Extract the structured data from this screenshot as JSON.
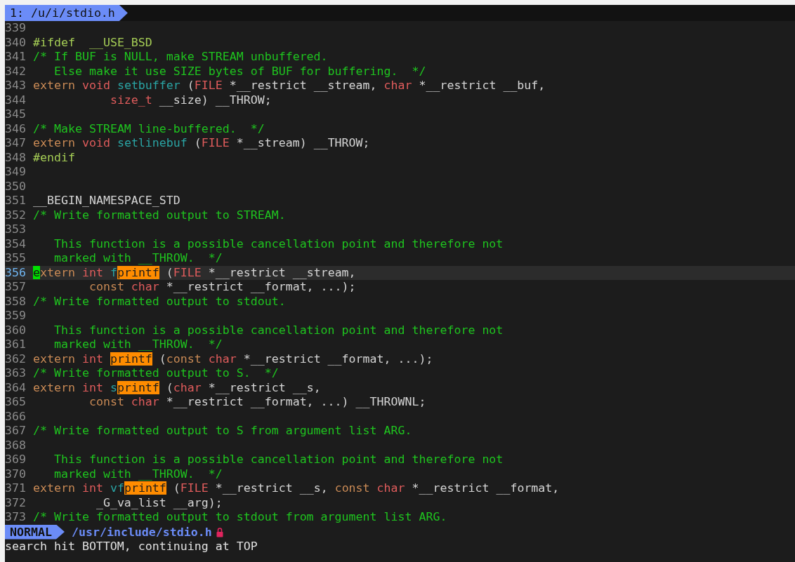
{
  "tabline": {
    "label": "1: /u/i/stdio.h"
  },
  "lines": [
    {
      "number": "339",
      "current": false
    },
    {
      "number": "340",
      "current": false,
      "tokens": [
        {
          "kind": "preproc",
          "text": "#ifdef  __USE_BSD"
        }
      ]
    },
    {
      "number": "341",
      "current": false,
      "tokens": [
        {
          "kind": "comment",
          "text": "/* If BUF is NULL, make STREAM unbuffered."
        }
      ]
    },
    {
      "number": "342",
      "current": false,
      "tokens": [
        {
          "kind": "comment",
          "text": "   Else make it use SIZE bytes of BUF for buffering.  */"
        }
      ]
    },
    {
      "number": "343",
      "current": false,
      "tokens": [
        {
          "kind": "keyword",
          "text": "extern"
        },
        {
          "kind": "type",
          "text": " void"
        },
        {
          "kind": "function",
          "text": " setbuffer"
        },
        {
          "kind": "plain",
          "text": " ("
        },
        {
          "kind": "type",
          "text": "FILE"
        },
        {
          "kind": "plain",
          "text": " *__restrict __stream, "
        },
        {
          "kind": "type",
          "text": "char"
        },
        {
          "kind": "plain",
          "text": " *__restrict __buf,"
        }
      ]
    },
    {
      "number": "344",
      "current": false,
      "tokens": [
        {
          "kind": "type",
          "text": "           size_t"
        },
        {
          "kind": "plain",
          "text": " __size) __THROW;"
        }
      ]
    },
    {
      "number": "345",
      "current": false
    },
    {
      "number": "346",
      "current": false,
      "tokens": [
        {
          "kind": "comment",
          "text": "/* Make STREAM line-buffered.  */"
        }
      ]
    },
    {
      "number": "347",
      "current": false,
      "tokens": [
        {
          "kind": "keyword",
          "text": "extern"
        },
        {
          "kind": "type",
          "text": " void"
        },
        {
          "kind": "function",
          "text": " setlinebuf"
        },
        {
          "kind": "plain",
          "text": " ("
        },
        {
          "kind": "type",
          "text": "FILE"
        },
        {
          "kind": "plain",
          "text": " *__stream) __THROW;"
        }
      ]
    },
    {
      "number": "348",
      "current": false,
      "tokens": [
        {
          "kind": "preproc",
          "text": "#endif"
        }
      ]
    },
    {
      "number": "349",
      "current": false
    },
    {
      "number": "350",
      "current": false
    },
    {
      "number": "351",
      "current": false,
      "tokens": [
        {
          "kind": "plain",
          "text": "__BEGIN_NAMESPACE_STD"
        }
      ]
    },
    {
      "number": "352",
      "current": false,
      "tokens": [
        {
          "kind": "comment",
          "text": "/* Write formatted output to STREAM."
        }
      ]
    },
    {
      "number": "353",
      "current": false
    },
    {
      "number": "354",
      "current": false,
      "tokens": [
        {
          "kind": "comment",
          "text": "   This function is a possible cancellation point and therefore not"
        }
      ]
    },
    {
      "number": "355",
      "current": false,
      "tokens": [
        {
          "kind": "comment",
          "text": "   marked with __THROW.  */"
        }
      ]
    },
    {
      "number": "356",
      "current": true,
      "tokens": [
        {
          "kind": "cursor",
          "text": "e"
        },
        {
          "kind": "keyword",
          "text": "xtern"
        },
        {
          "kind": "type",
          "text": " int"
        },
        {
          "kind": "function",
          "text": " f"
        },
        {
          "kind": "match",
          "text": "printf"
        },
        {
          "kind": "plain",
          "text": " ("
        },
        {
          "kind": "type",
          "text": "FILE"
        },
        {
          "kind": "plain",
          "text": " *__restrict __stream,"
        }
      ]
    },
    {
      "number": "357",
      "current": false,
      "tokens": [
        {
          "kind": "keyword",
          "text": "        const"
        },
        {
          "kind": "type",
          "text": " char"
        },
        {
          "kind": "plain",
          "text": " *__restrict __format, ...);"
        }
      ]
    },
    {
      "number": "358",
      "current": false,
      "tokens": [
        {
          "kind": "comment",
          "text": "/* Write formatted output to stdout."
        }
      ]
    },
    {
      "number": "359",
      "current": false
    },
    {
      "number": "360",
      "current": false,
      "tokens": [
        {
          "kind": "comment",
          "text": "   This function is a possible cancellation point and therefore not"
        }
      ]
    },
    {
      "number": "361",
      "current": false,
      "tokens": [
        {
          "kind": "comment",
          "text": "   marked with __THROW.  */"
        }
      ]
    },
    {
      "number": "362",
      "current": false,
      "tokens": [
        {
          "kind": "keyword",
          "text": "extern"
        },
        {
          "kind": "type",
          "text": " int "
        },
        {
          "kind": "match",
          "text": "printf"
        },
        {
          "kind": "plain",
          "text": " ("
        },
        {
          "kind": "keyword",
          "text": "const"
        },
        {
          "kind": "type",
          "text": " char"
        },
        {
          "kind": "plain",
          "text": " *__restrict __format, ...);"
        }
      ]
    },
    {
      "number": "363",
      "current": false,
      "tokens": [
        {
          "kind": "comment",
          "text": "/* Write formatted output to S.  */"
        }
      ]
    },
    {
      "number": "364",
      "current": false,
      "tokens": [
        {
          "kind": "keyword",
          "text": "extern"
        },
        {
          "kind": "type",
          "text": " int"
        },
        {
          "kind": "function",
          "text": " s"
        },
        {
          "kind": "match",
          "text": "printf"
        },
        {
          "kind": "plain",
          "text": " ("
        },
        {
          "kind": "type",
          "text": "char"
        },
        {
          "kind": "plain",
          "text": " *__restrict __s,"
        }
      ]
    },
    {
      "number": "365",
      "current": false,
      "tokens": [
        {
          "kind": "keyword",
          "text": "        const"
        },
        {
          "kind": "type",
          "text": " char"
        },
        {
          "kind": "plain",
          "text": " *__restrict __format, ...) __THROWNL;"
        }
      ]
    },
    {
      "number": "366",
      "current": false
    },
    {
      "number": "367",
      "current": false,
      "tokens": [
        {
          "kind": "comment",
          "text": "/* Write formatted output to S from argument list ARG."
        }
      ]
    },
    {
      "number": "368",
      "current": false
    },
    {
      "number": "369",
      "current": false,
      "tokens": [
        {
          "kind": "comment",
          "text": "   This function is a possible cancellation point and therefore not"
        }
      ]
    },
    {
      "number": "370",
      "current": false,
      "tokens": [
        {
          "kind": "comment",
          "text": "   marked with __THROW.  */"
        }
      ]
    },
    {
      "number": "371",
      "current": false,
      "tokens": [
        {
          "kind": "keyword",
          "text": "extern"
        },
        {
          "kind": "type",
          "text": " int"
        },
        {
          "kind": "function",
          "text": " vf"
        },
        {
          "kind": "match",
          "text": "printf"
        },
        {
          "kind": "plain",
          "text": " ("
        },
        {
          "kind": "type",
          "text": "FILE"
        },
        {
          "kind": "plain",
          "text": " *__restrict __s, "
        },
        {
          "kind": "keyword",
          "text": "const"
        },
        {
          "kind": "type",
          "text": " char"
        },
        {
          "kind": "plain",
          "text": " *__restrict __format,"
        }
      ]
    },
    {
      "number": "372",
      "current": false,
      "tokens": [
        {
          "kind": "plain",
          "text": "         _G_va_list __arg);"
        }
      ]
    },
    {
      "number": "373",
      "current": false,
      "tokens": [
        {
          "kind": "comment",
          "text": "/* Write formatted output to stdout from argument list ARG."
        }
      ]
    }
  ],
  "statusline": {
    "mode": "NORMAL",
    "path": "/usr/include/stdio.h",
    "readonly": true
  },
  "message": "search hit BOTTOM, continuing at TOP"
}
